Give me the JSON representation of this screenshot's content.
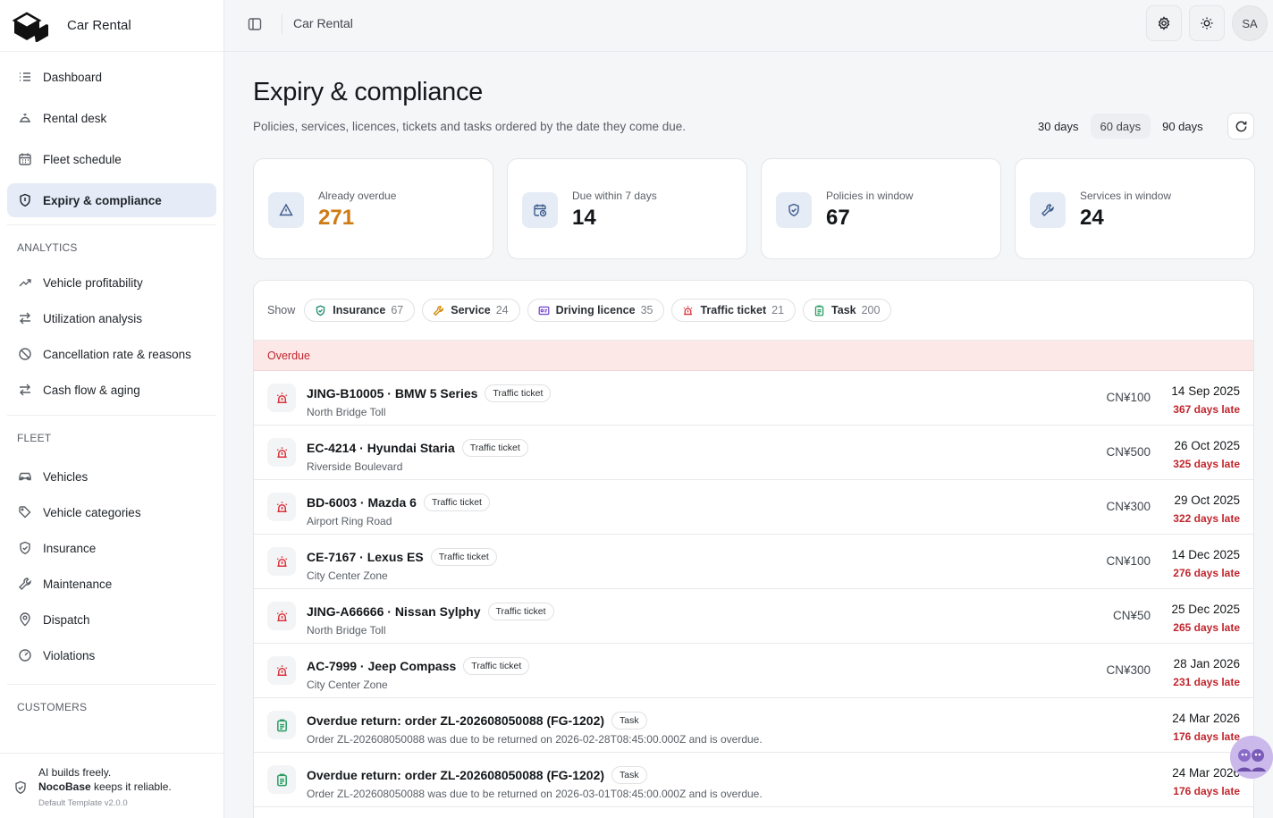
{
  "app": {
    "name": "Car Rental"
  },
  "topbar": {
    "breadcrumb": "Car Rental",
    "avatar_initials": "SA"
  },
  "sidebar": {
    "main_items": [
      {
        "label": "Dashboard",
        "icon": "list-icon"
      },
      {
        "label": "Rental desk",
        "icon": "desk-bell-icon"
      },
      {
        "label": "Fleet schedule",
        "icon": "calendar-icon"
      },
      {
        "label": "Expiry & compliance",
        "icon": "shield-icon",
        "active": true
      }
    ],
    "analytics_label": "ANALYTICS",
    "analytics_items": [
      {
        "label": "Vehicle profitability",
        "icon": "trend-up-icon"
      },
      {
        "label": "Utilization analysis",
        "icon": "swap-icon"
      },
      {
        "label": "Cancellation rate & reasons",
        "icon": "ban-icon"
      },
      {
        "label": "Cash flow & aging",
        "icon": "swap-icon"
      }
    ],
    "fleet_label": "FLEET",
    "fleet_items": [
      {
        "label": "Vehicles",
        "icon": "car-icon"
      },
      {
        "label": "Vehicle categories",
        "icon": "tags-icon"
      },
      {
        "label": "Insurance",
        "icon": "shield-icon"
      },
      {
        "label": "Maintenance",
        "icon": "wrench-icon"
      },
      {
        "label": "Dispatch",
        "icon": "map-pin-icon"
      },
      {
        "label": "Violations",
        "icon": "gauge-icon"
      }
    ],
    "customers_label": "CUSTOMERS",
    "footer": {
      "line1": "AI builds freely.",
      "line2_bold": "NocoBase",
      "line2_rest": " keeps it reliable.",
      "version": "Default Template v2.0.0"
    }
  },
  "page": {
    "title": "Expiry & compliance",
    "subtitle": "Policies, services, licences, tickets and tasks ordered by the date they come due.",
    "ranges": [
      "30 days",
      "60 days",
      "90 days"
    ],
    "selected_range": "60 days"
  },
  "cards": [
    {
      "label": "Already overdue",
      "value": "271",
      "icon": "alert-triangle-icon",
      "warn": true
    },
    {
      "label": "Due within 7 days",
      "value": "14",
      "icon": "calendar-clock-icon"
    },
    {
      "label": "Policies in window",
      "value": "67",
      "icon": "shield-check-icon"
    },
    {
      "label": "Services in window",
      "value": "24",
      "icon": "wrench-icon"
    }
  ],
  "filters": {
    "show_label": "Show",
    "chips": [
      {
        "label": "Insurance",
        "count": "67",
        "icon": "shield-check-icon",
        "color": "#1f8a70"
      },
      {
        "label": "Service",
        "count": "24",
        "icon": "wrench-icon",
        "color": "#d48806"
      },
      {
        "label": "Driving licence",
        "count": "35",
        "icon": "id-card-icon",
        "color": "#7b4fd1"
      },
      {
        "label": "Traffic ticket",
        "count": "21",
        "icon": "siren-icon",
        "color": "#d9363e"
      },
      {
        "label": "Task",
        "count": "200",
        "icon": "clipboard-icon",
        "color": "#2a9d63"
      }
    ]
  },
  "group_overdue": "Overdue",
  "rows": [
    {
      "name": "JING-B10005 · BMW 5 Series",
      "tag": "Traffic ticket",
      "sub": "North Bridge Toll",
      "amount": "CN¥100",
      "date": "14 Sep 2025",
      "late": "367 days late",
      "kind": "ticket"
    },
    {
      "name": "EC-4214 · Hyundai Staria",
      "tag": "Traffic ticket",
      "sub": "Riverside Boulevard",
      "amount": "CN¥500",
      "date": "26 Oct 2025",
      "late": "325 days late",
      "kind": "ticket"
    },
    {
      "name": "BD-6003 · Mazda 6",
      "tag": "Traffic ticket",
      "sub": "Airport Ring Road",
      "amount": "CN¥300",
      "date": "29 Oct 2025",
      "late": "322 days late",
      "kind": "ticket"
    },
    {
      "name": "CE-7167 · Lexus ES",
      "tag": "Traffic ticket",
      "sub": "City Center Zone",
      "amount": "CN¥100",
      "date": "14 Dec 2025",
      "late": "276 days late",
      "kind": "ticket"
    },
    {
      "name": "JING-A66666 · Nissan Sylphy",
      "tag": "Traffic ticket",
      "sub": "North Bridge Toll",
      "amount": "CN¥50",
      "date": "25 Dec 2025",
      "late": "265 days late",
      "kind": "ticket"
    },
    {
      "name": "AC-7999 · Jeep Compass",
      "tag": "Traffic ticket",
      "sub": "City Center Zone",
      "amount": "CN¥300",
      "date": "28 Jan 2026",
      "late": "231 days late",
      "kind": "ticket"
    },
    {
      "name": "Overdue return: order ZL-202608050088 (FG-1202)",
      "tag": "Task",
      "sub": "Order ZL-202608050088 was due to be returned on 2026-02-28T08:45:00.000Z and is overdue.",
      "amount": "",
      "date": "24 Mar 2026",
      "late": "176 days late",
      "kind": "task"
    },
    {
      "name": "Overdue return: order ZL-202608050088 (FG-1202)",
      "tag": "Task",
      "sub": "Order ZL-202608050088 was due to be returned on 2026-03-01T08:45:00.000Z and is overdue.",
      "amount": "",
      "date": "24 Mar 2026",
      "late": "176 days late",
      "kind": "task"
    }
  ]
}
